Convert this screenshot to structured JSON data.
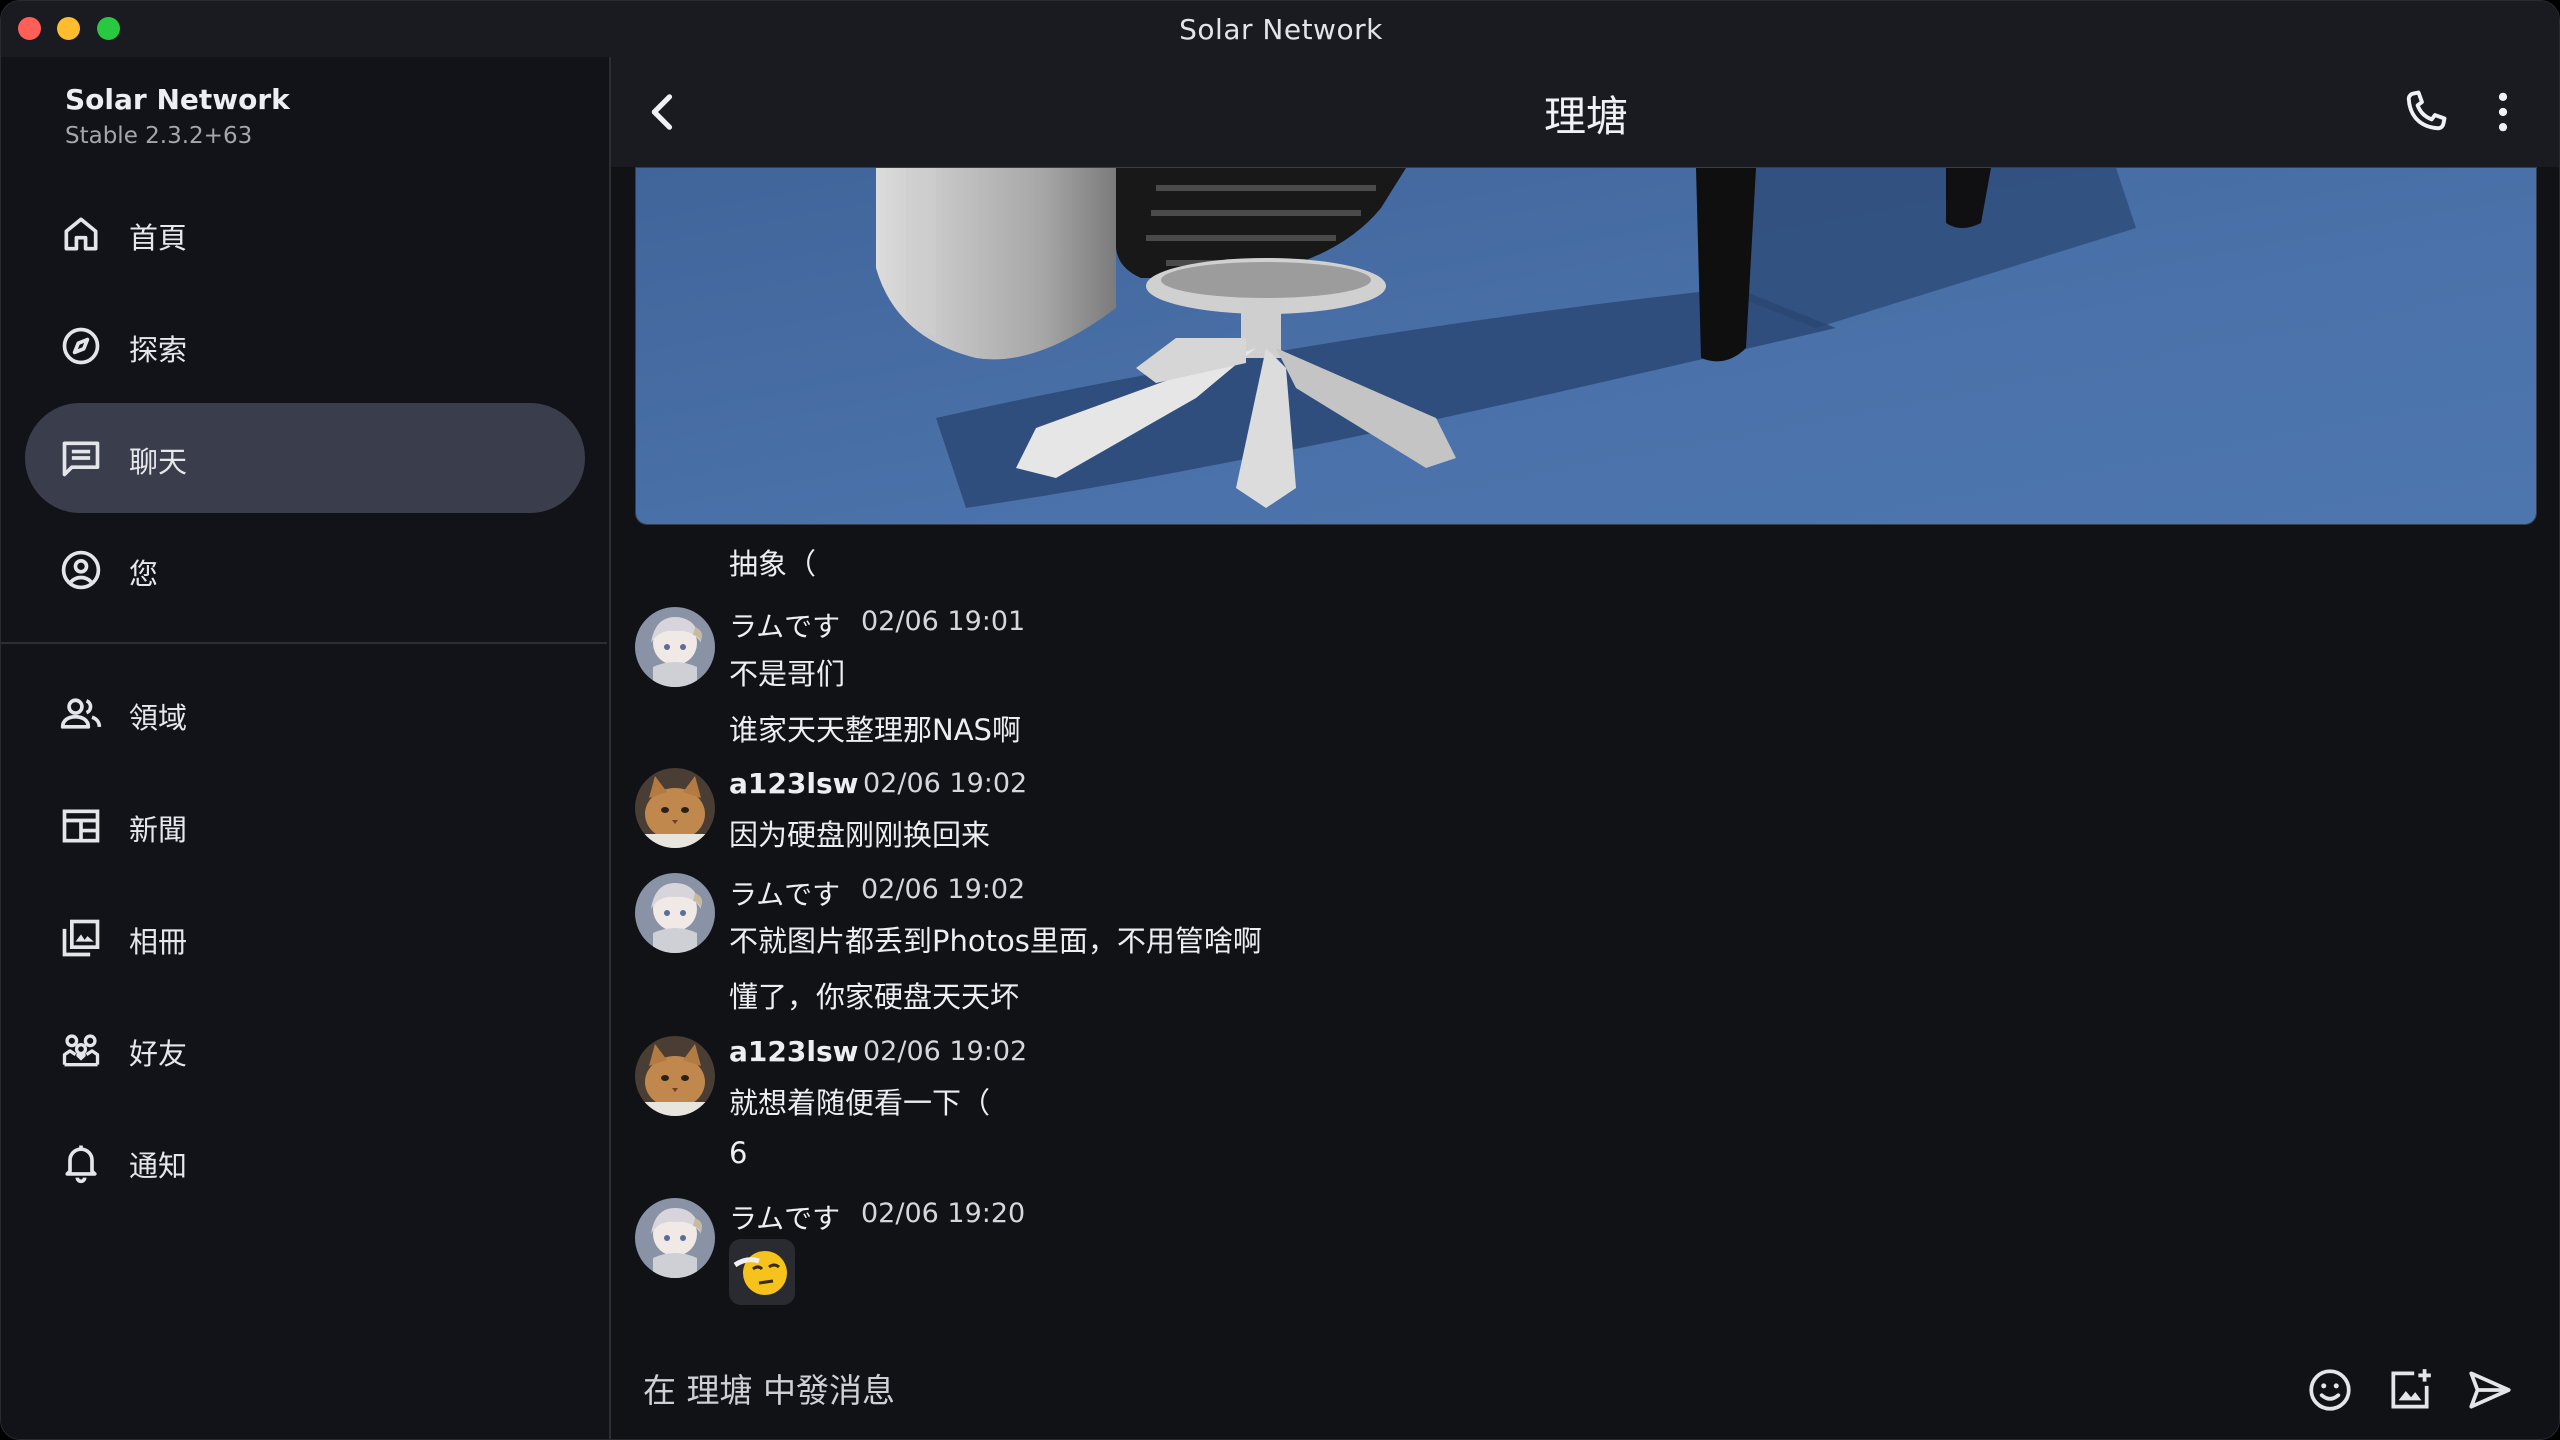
{
  "window": {
    "title": "Solar Network"
  },
  "sidebar": {
    "app_name": "Solar Network",
    "version": "Stable 2.3.2+63",
    "primary_items": [
      {
        "label": "首頁",
        "icon": "home-icon"
      },
      {
        "label": "探索",
        "icon": "compass-icon"
      },
      {
        "label": "聊天",
        "icon": "chat-icon",
        "active": true
      },
      {
        "label": "您",
        "icon": "account-icon"
      }
    ],
    "secondary_items": [
      {
        "label": "領域",
        "icon": "people-icon"
      },
      {
        "label": "新聞",
        "icon": "news-icon"
      },
      {
        "label": "相冊",
        "icon": "album-icon"
      },
      {
        "label": "好友",
        "icon": "friends-icon"
      },
      {
        "label": "通知",
        "icon": "bell-icon"
      }
    ]
  },
  "chat": {
    "title": "理塘",
    "messages": [
      {
        "text": "抽象（"
      },
      {
        "sender": "ラムです",
        "time": "02/06 19:01",
        "lines": [
          "不是哥们",
          "谁家天天整理那NAS啊"
        ]
      },
      {
        "sender": "a123lsw",
        "time": "02/06 19:02",
        "lines": [
          "因为硬盘刚刚换回来"
        ]
      },
      {
        "sender": "ラムです",
        "time": "02/06 19:02",
        "lines": [
          "不就图片都丢到Photos里面，不用管啥啊",
          "懂了，你家硬盘天天坏"
        ]
      },
      {
        "sender": "a123lsw",
        "time": "02/06 19:02",
        "lines": [
          "就想着随便看一下（",
          "6"
        ]
      },
      {
        "sender": "ラムです",
        "time": "02/06 19:20",
        "sticker": "thinking-emoji-sticker"
      }
    ],
    "composer": {
      "placeholder": "在 理塘 中發消息"
    }
  },
  "colors": {
    "window_bg": "#121318",
    "header_bg": "#1a1b21",
    "active_nav": "#3a3d4b",
    "text": "#eceef2"
  }
}
